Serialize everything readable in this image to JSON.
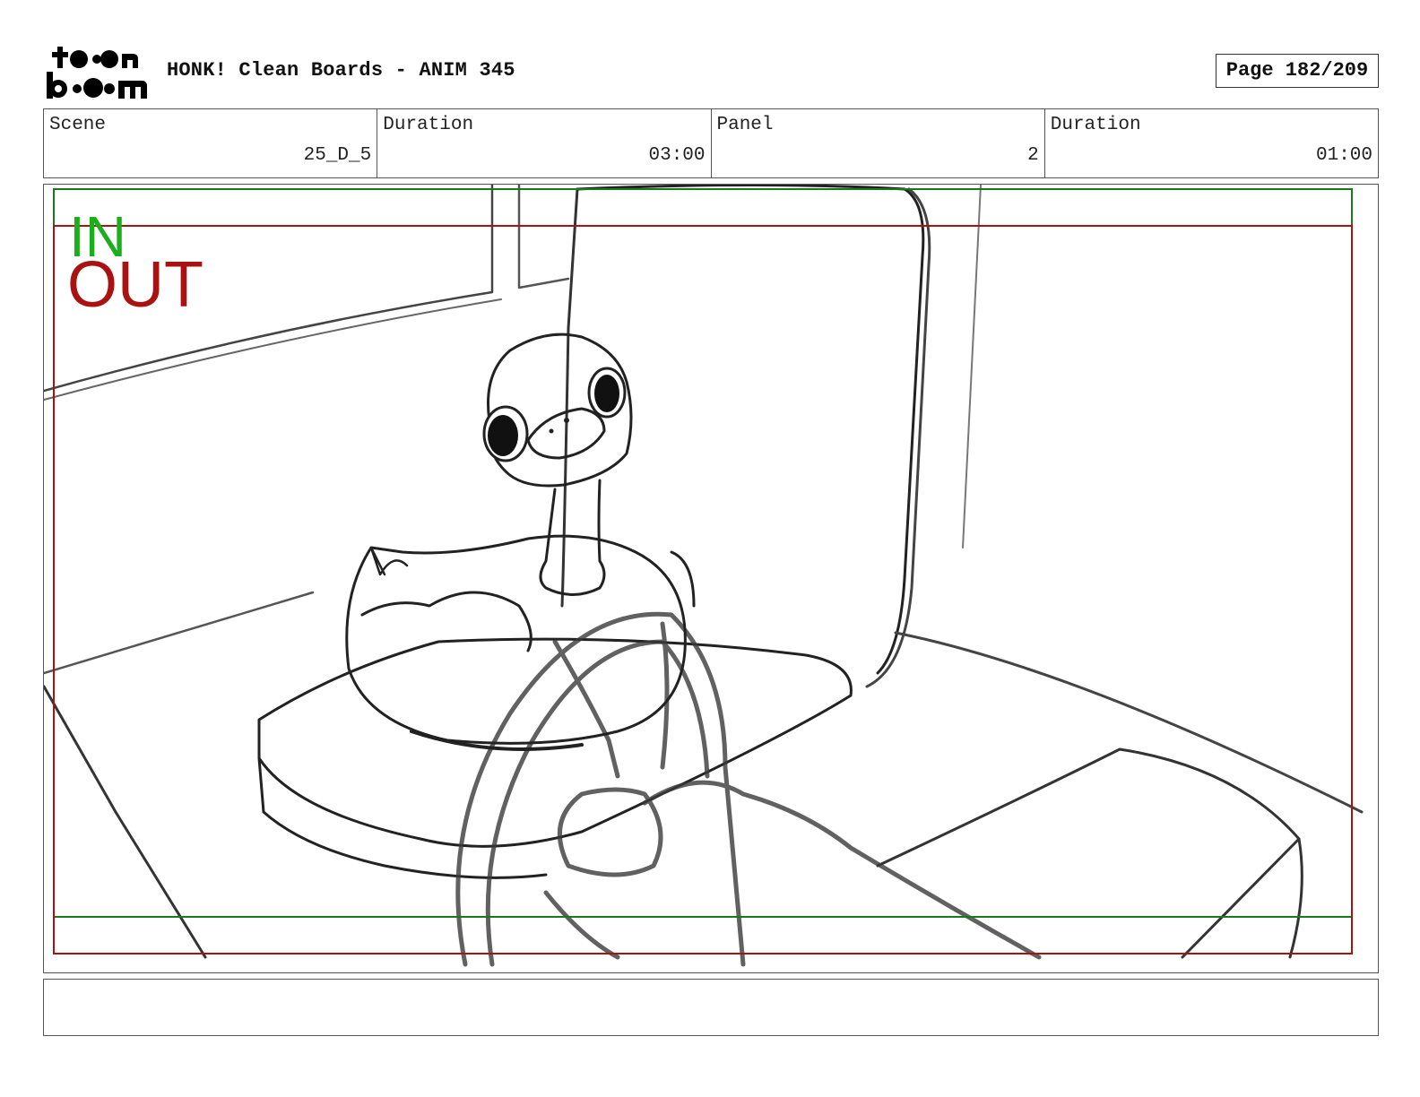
{
  "header": {
    "logo_text_top": "toon",
    "logo_text_bottom": "boom",
    "title": "HONK! Clean Boards - ANIM 345",
    "page_label": "Page 182/209"
  },
  "info_bar": [
    {
      "label": "Scene",
      "value": "25_D_5"
    },
    {
      "label": "Duration",
      "value": "03:00"
    },
    {
      "label": "Panel",
      "value": "2"
    },
    {
      "label": "Duration",
      "value": "01:00"
    }
  ],
  "panel": {
    "in_label": "IN",
    "out_label": "OUT",
    "colors": {
      "in_frame": "#1a7a1a",
      "out_frame": "#aa1111",
      "in_text": "#1cae1c",
      "out_text": "#aa1111"
    }
  },
  "notes": {
    "text": ""
  }
}
